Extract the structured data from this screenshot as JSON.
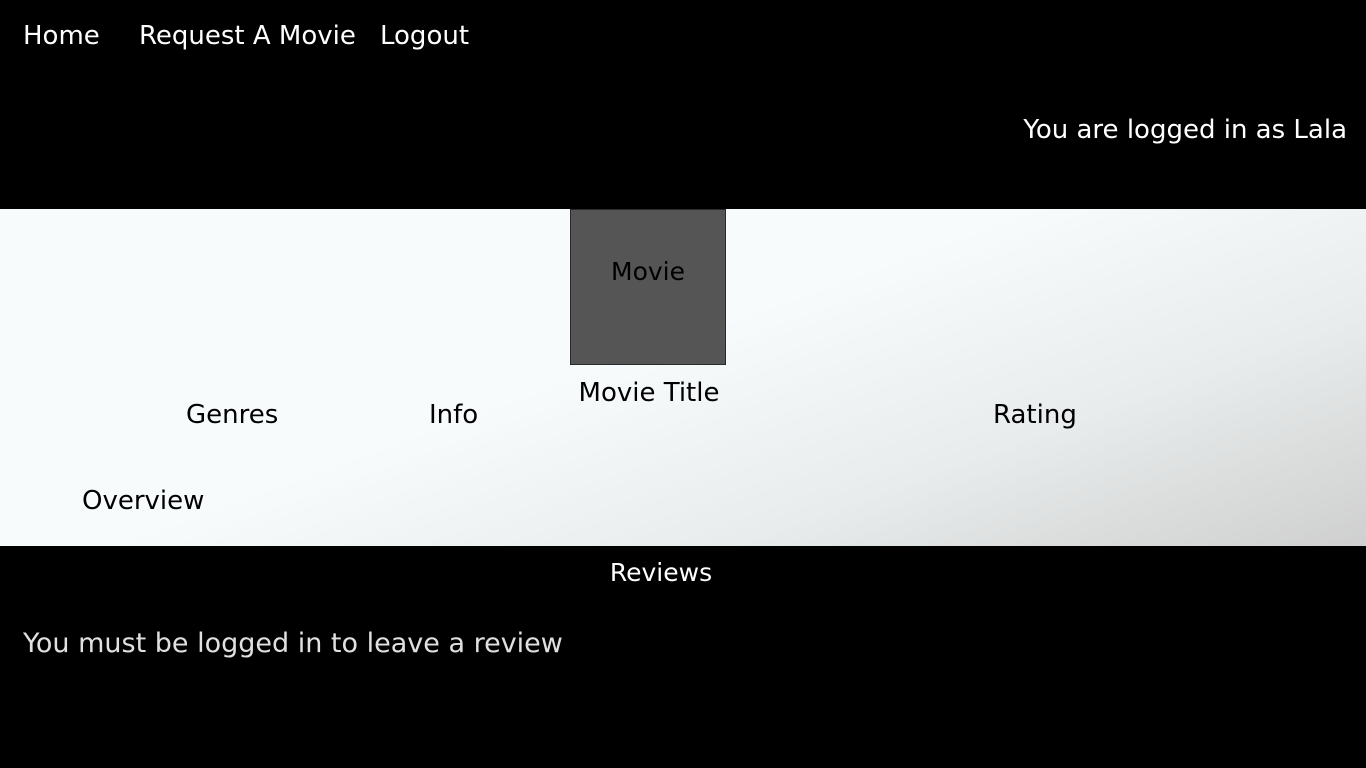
{
  "nav": {
    "home_label": "Home",
    "request_label": "Request A Movie",
    "logout_label": "Logout"
  },
  "header": {
    "login_status": "You are logged in as Lala"
  },
  "movie": {
    "poster_label": "Movie",
    "title": "Movie Title",
    "genres_label": "Genres",
    "info_label": "Info",
    "rating_label": "Rating",
    "overview_label": "Overview"
  },
  "reviews": {
    "heading": "Reviews",
    "login_notice": "You must be logged in to leave a review"
  },
  "colors": {
    "background": "#000000",
    "panel_light": "#f7fbfc",
    "panel_dark": "#cfcfcf",
    "poster": "#555555",
    "text_light": "#ffffff",
    "text_dark": "#000000"
  }
}
